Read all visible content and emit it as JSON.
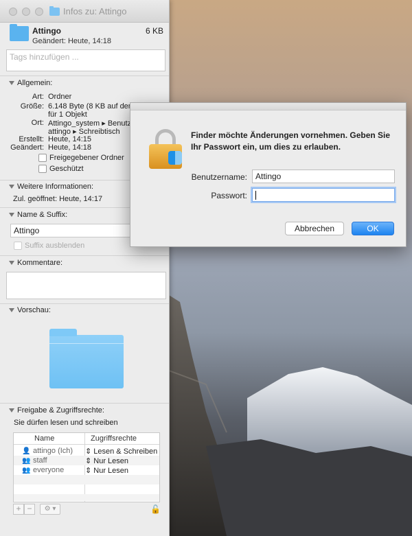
{
  "info_window": {
    "title": "Infos zu: Attingo",
    "file_name": "Attingo",
    "file_size": "6 KB",
    "modified": "Geändert: Heute, 14:18",
    "tags_placeholder": "Tags hinzufügen ...",
    "general": {
      "header": "Allgemein:",
      "kind_label": "Art:",
      "kind_value": "Ordner",
      "size_label": "Größe:",
      "size_value_line1": "6.148 Byte (8 KB auf dem Volume)",
      "size_value_line2": "für 1 Objekt",
      "where_label": "Ort:",
      "where_value_line1": "Attingo_system ▸ Benutzer ▸",
      "where_value_line2": "attingo ▸ Schreibtisch",
      "created_label": "Erstellt:",
      "created_value": "Heute, 14:15",
      "modified_label": "Geändert:",
      "modified_value": "Heute, 14:18",
      "shared_folder": "Freigegebener Ordner",
      "locked": "Geschützt"
    },
    "more_info": {
      "header": "Weitere Informationen:",
      "last_opened": "Zul. geöffnet: Heute, 14:17"
    },
    "name_ext": {
      "header": "Name & Suffix:",
      "name_value": "Attingo",
      "hide_ext": "Suffix ausblenden"
    },
    "comments": {
      "header": "Kommentare:"
    },
    "preview": {
      "header": "Vorschau:"
    },
    "sharing": {
      "header": "Freigabe & Zugriffsrechte:",
      "summary": "Sie dürfen lesen und schreiben",
      "col_name": "Name",
      "col_priv": "Zugriffsrechte",
      "rows": [
        {
          "name": "attingo (Ich)",
          "priv": "Lesen & Schreiben"
        },
        {
          "name": "staff",
          "priv": "Nur Lesen"
        },
        {
          "name": "everyone",
          "priv": "Nur Lesen"
        }
      ],
      "add_label": "+",
      "remove_label": "−"
    }
  },
  "auth_dialog": {
    "message": "Finder möchte Änderungen vornehmen. Geben Sie Ihr Passwort ein, um dies zu erlauben.",
    "username_label": "Benutzername:",
    "username_value": "Attingo",
    "password_label": "Passwort:",
    "password_value": "",
    "cancel_label": "Abbrechen",
    "ok_label": "OK"
  }
}
